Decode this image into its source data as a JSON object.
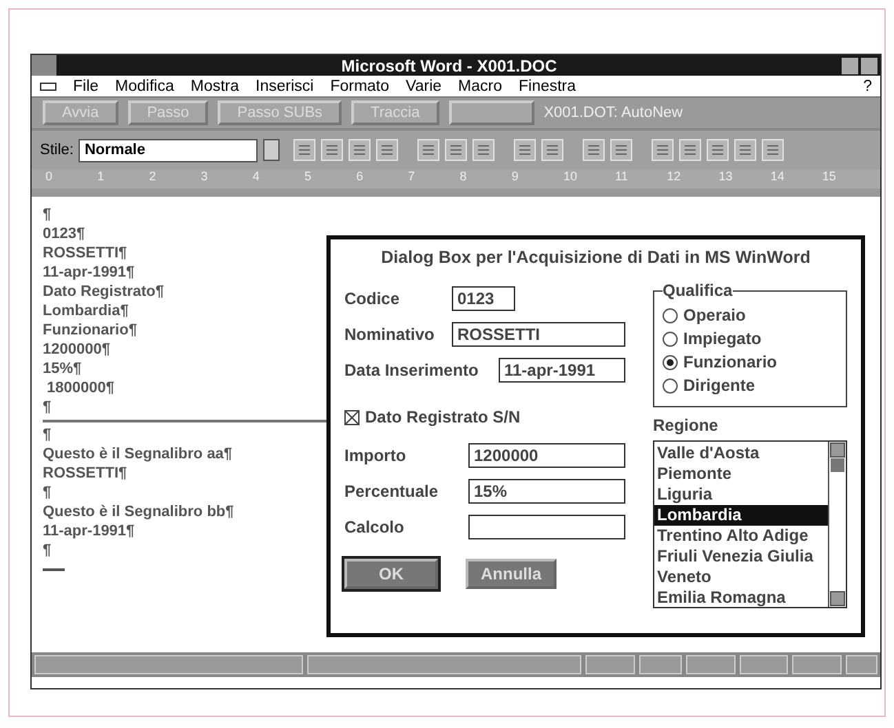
{
  "window": {
    "title": "Microsoft Word - X001.DOC"
  },
  "menu": {
    "items": [
      "File",
      "Modifica",
      "Mostra",
      "Inserisci",
      "Formato",
      "Varie",
      "Macro",
      "Finestra"
    ],
    "help": "?"
  },
  "macro_toolbar": {
    "buttons": [
      "Avvia",
      "Passo",
      "Passo SUBs",
      "Traccia"
    ],
    "status": "X001.DOT: AutoNew"
  },
  "format_toolbar": {
    "style_label": "Stile:",
    "style_value": "Normale"
  },
  "ruler": {
    "ticks": [
      "0",
      "1",
      "2",
      "3",
      "4",
      "5",
      "6",
      "7",
      "8",
      "9",
      "10",
      "11",
      "12",
      "13",
      "14",
      "15"
    ]
  },
  "document": {
    "upper_lines": [
      "¶",
      "0123¶",
      "ROSSETTI¶",
      "11-apr-1991¶",
      "Dato Registrato¶",
      "Lombardia¶",
      "Funzionario¶",
      "1200000¶",
      "15%¶",
      " 1800000¶",
      "¶"
    ],
    "lower_lines": [
      "¶",
      "Questo è il Segnalibro aa¶",
      "ROSSETTI¶",
      "¶",
      "Questo è il Segnalibro bb¶",
      "11-apr-1991¶",
      "¶"
    ]
  },
  "dialog": {
    "title": "Dialog Box per l'Acquisizione di Dati in MS WinWord",
    "fields_top": [
      {
        "label": "Codice",
        "value": "0123"
      },
      {
        "label": "Nominativo",
        "value": "ROSSETTI"
      },
      {
        "label": "Data Inserimento",
        "value": "11-apr-1991"
      }
    ],
    "qualifica": {
      "label": "Qualifica",
      "options": [
        {
          "label": "Operaio",
          "selected": false
        },
        {
          "label": "Impiegato",
          "selected": false
        },
        {
          "label": "Funzionario",
          "selected": true
        },
        {
          "label": "Dirigente",
          "selected": false
        }
      ]
    },
    "checkbox": {
      "label": "Dato Registrato S/N",
      "checked": true
    },
    "regione": {
      "label": "Regione",
      "items": [
        {
          "label": "Valle d'Aosta",
          "selected": false
        },
        {
          "label": "Piemonte",
          "selected": false
        },
        {
          "label": "Liguria",
          "selected": false
        },
        {
          "label": "Lombardia",
          "selected": true
        },
        {
          "label": "Trentino Alto Adige",
          "selected": false
        },
        {
          "label": "Friuli Venezia Giulia",
          "selected": false
        },
        {
          "label": "Veneto",
          "selected": false
        },
        {
          "label": "Emilia Romagna",
          "selected": false
        }
      ]
    },
    "fields_bottom": [
      {
        "label": "Importo",
        "value": "1200000"
      },
      {
        "label": "Percentuale",
        "value": "15%"
      },
      {
        "label": "Calcolo"
      }
    ],
    "buttons": [
      {
        "label": "OK",
        "default": true
      },
      {
        "label": "Annulla",
        "default": false
      }
    ]
  }
}
